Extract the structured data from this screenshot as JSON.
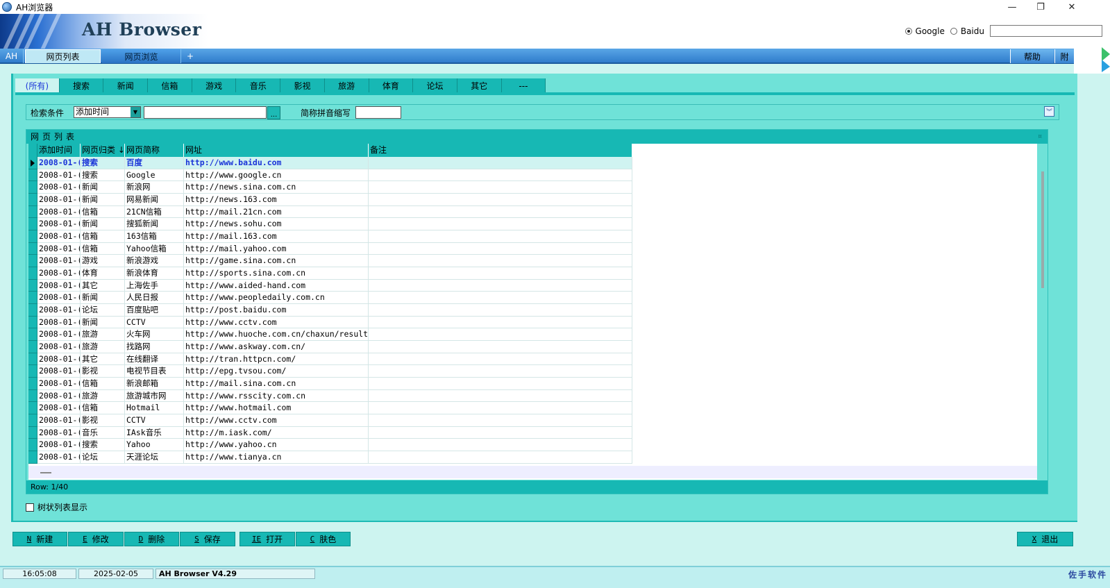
{
  "window": {
    "title": "AH浏览器",
    "minimize_icon": "—",
    "restore_icon": "❐",
    "close_icon": "✕"
  },
  "header": {
    "brand": "AH Browser",
    "engines": [
      {
        "label": "Google",
        "selected": true
      },
      {
        "label": "Baidu",
        "selected": false
      }
    ],
    "search_value": ""
  },
  "main_tabs": [
    {
      "label": "AH"
    },
    {
      "label": "网页列表"
    },
    {
      "label": "网页浏览"
    },
    {
      "label": "+"
    }
  ],
  "right_tabs": [
    {
      "label": "帮助"
    },
    {
      "label": "附"
    }
  ],
  "categories": [
    "(所有)",
    "搜索",
    "新闻",
    "信箱",
    "游戏",
    "音乐",
    "影视",
    "旅游",
    "体育",
    "论坛",
    "其它",
    "---"
  ],
  "search": {
    "label": "检索条件",
    "field_value": "添加时间",
    "keyword": "",
    "dots": "...",
    "pinyin_label": "简称拼音缩写",
    "pinyin_value": ""
  },
  "grid": {
    "title": "网页列表",
    "mini_icon": "¤",
    "columns": [
      "添加时间",
      "网页归类 ↓",
      "网页简称",
      "网址",
      "备注"
    ],
    "rows": [
      [
        "2008-01-(",
        "搜索",
        "百度",
        "http://www.baidu.com",
        ""
      ],
      [
        "2008-01-(",
        "搜索",
        "Google",
        "http://www.google.cn",
        ""
      ],
      [
        "2008-01-(",
        "新闻",
        "新浪网",
        "http://news.sina.com.cn",
        ""
      ],
      [
        "2008-01-(",
        "新闻",
        "网易新闻",
        "http://news.163.com",
        ""
      ],
      [
        "2008-01-(",
        "信箱",
        "21CN信箱",
        "http://mail.21cn.com",
        ""
      ],
      [
        "2008-01-(",
        "新闻",
        "搜狐新闻",
        "http://news.sohu.com",
        ""
      ],
      [
        "2008-01-(",
        "信箱",
        "163信箱",
        "http://mail.163.com",
        ""
      ],
      [
        "2008-01-(",
        "信箱",
        "Yahoo信箱",
        "http://mail.yahoo.com",
        ""
      ],
      [
        "2008-01-(",
        "游戏",
        "新浪游戏",
        "http://game.sina.com.cn",
        ""
      ],
      [
        "2008-01-(",
        "体育",
        "新浪体育",
        "http://sports.sina.com.cn",
        ""
      ],
      [
        "2008-01-(",
        "其它",
        "上海佐手",
        "http://www.aided-hand.com",
        ""
      ],
      [
        "2008-01-(",
        "新闻",
        "人民日报",
        "http://www.peopledaily.com.cn",
        ""
      ],
      [
        "2008-01-(",
        "论坛",
        "百度贴吧",
        "http://post.baidu.com",
        ""
      ],
      [
        "2008-01-(",
        "新闻",
        "CCTV",
        "http://www.cctv.com",
        ""
      ],
      [
        "2008-01-(",
        "旅游",
        "火车网",
        "http://www.huoche.com.cn/chaxun/result.",
        ""
      ],
      [
        "2008-01-(",
        "旅游",
        "找路网",
        "http://www.askway.com.cn/",
        ""
      ],
      [
        "2008-01-(",
        "其它",
        "在线翻译",
        "http://tran.httpcn.com/",
        ""
      ],
      [
        "2008-01-(",
        "影视",
        "电视节目表",
        "http://epg.tvsou.com/",
        ""
      ],
      [
        "2008-01-(",
        "信箱",
        "新浪邮箱",
        "http://mail.sina.com.cn",
        ""
      ],
      [
        "2008-01-(",
        "旅游",
        "旅游城市网",
        "http://www.rsscity.com.cn",
        ""
      ],
      [
        "2008-01-(",
        "信箱",
        "Hotmail",
        "http://www.hotmail.com",
        ""
      ],
      [
        "2008-01-(",
        "影视",
        "CCTV",
        "http://www.cctv.com",
        ""
      ],
      [
        "2008-01-(",
        "音乐",
        "IAsk音乐",
        "http://m.iask.com/",
        ""
      ],
      [
        "2008-01-(",
        "搜索",
        "Yahoo",
        "http://www.yahoo.cn",
        ""
      ],
      [
        "2008-01-(",
        "论坛",
        "天涯论坛",
        "http://www.tianya.cn",
        ""
      ]
    ],
    "status": "Row: 1/40"
  },
  "tree_toggle": {
    "label": "树状列表显示",
    "checked": false
  },
  "buttons": [
    {
      "key": "N",
      "label": "新建"
    },
    {
      "key": "E",
      "label": "修改"
    },
    {
      "key": "D",
      "label": "删除"
    },
    {
      "key": "S",
      "label": "保存"
    },
    {
      "key": "IE",
      "label": "打开"
    },
    {
      "key": "C",
      "label": "肤色"
    }
  ],
  "exit_button": {
    "key": "X",
    "label": "退出"
  },
  "statusbar": {
    "time": "16:05:08",
    "date": "2025-02-05",
    "version": "AH Browser V4.29",
    "watermark": "佐手软件"
  },
  "colors": {
    "panel": "#6fe2d8",
    "tab": "#17b8b4",
    "selected_text": "#1b35d8",
    "header_blue": "#2f7ccc"
  }
}
